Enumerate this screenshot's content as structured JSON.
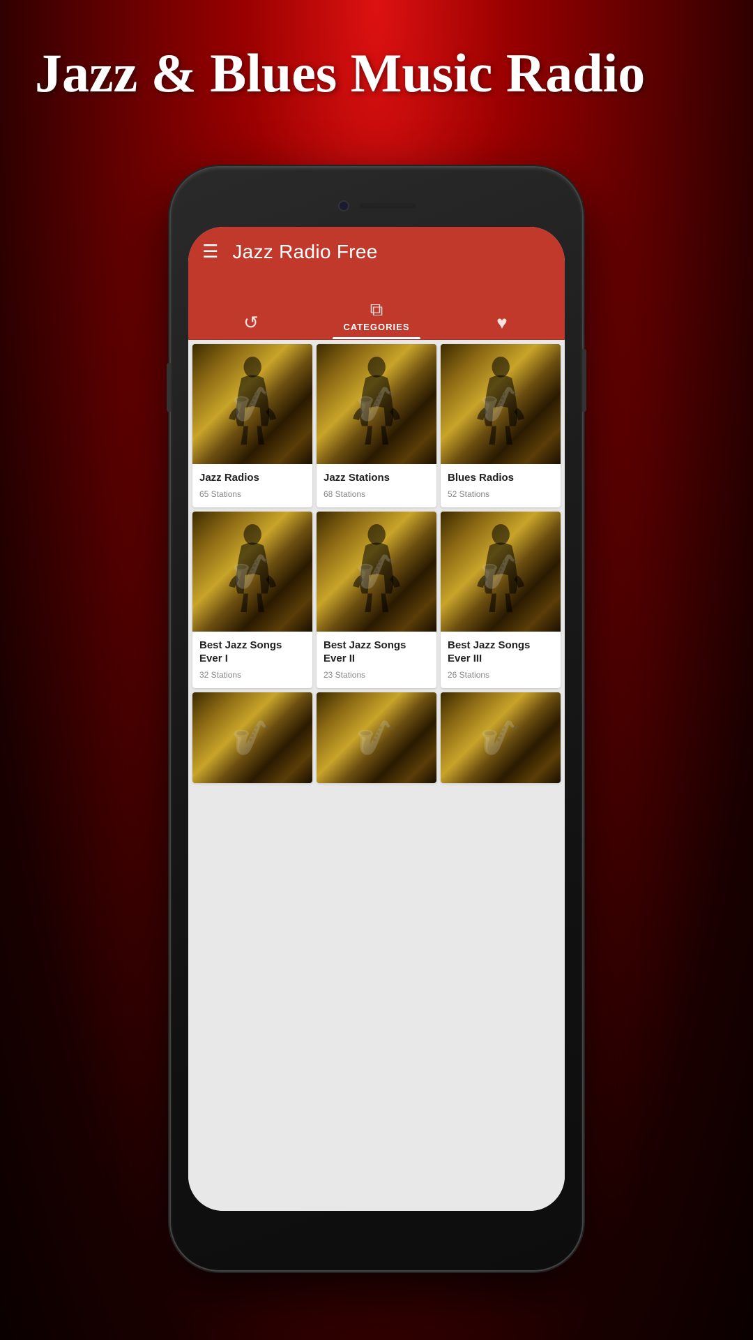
{
  "page": {
    "title": "Jazz & Blues Music Radio",
    "bg_color": "#cc0000"
  },
  "app": {
    "title": "Jazz Radio Free",
    "menu_icon": "☰",
    "tabs": [
      {
        "id": "history",
        "icon": "↺",
        "label": "",
        "active": false
      },
      {
        "id": "categories",
        "icon": "⧉",
        "label": "CATEGORIES",
        "active": true
      },
      {
        "id": "favorites",
        "icon": "♥",
        "label": "",
        "active": false
      }
    ]
  },
  "categories": [
    {
      "title": "Jazz Radios",
      "stations": "65 Stations"
    },
    {
      "title": "Jazz Stations",
      "stations": "68 Stations"
    },
    {
      "title": "Blues Radios",
      "stations": "52 Stations"
    },
    {
      "title": "Best Jazz Songs Ever I",
      "stations": "32 Stations"
    },
    {
      "title": "Best Jazz Songs Ever II",
      "stations": "23 Stations"
    },
    {
      "title": "Best Jazz Songs Ever III",
      "stations": "26 Stations"
    }
  ],
  "partial_row": [
    {
      "title": "...",
      "stations": "..."
    },
    {
      "title": "...",
      "stations": "..."
    },
    {
      "title": "...",
      "stations": "..."
    }
  ]
}
